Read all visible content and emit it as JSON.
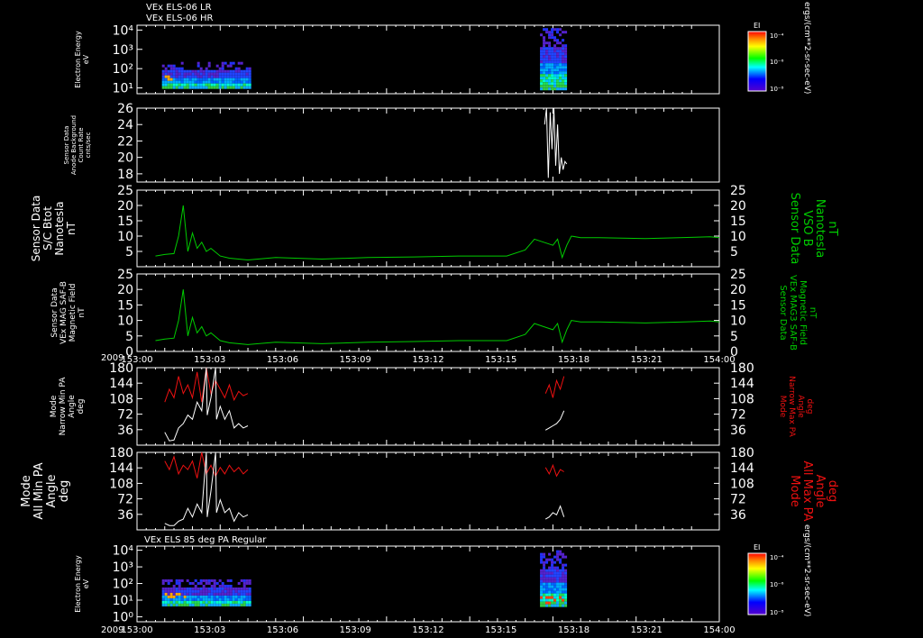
{
  "header": {
    "title1": "VEx ELS-06 LR",
    "title2": "VEx ELS-06 HR"
  },
  "colors": {
    "white": "#ffffff",
    "green": "#00cc00",
    "red": "#ee1111",
    "black": "#000000"
  },
  "time_axis": {
    "year": "2009",
    "ticks": [
      "153:00",
      "153:03",
      "153:06",
      "153:09",
      "153:12",
      "153:15",
      "153:18",
      "153:21",
      "154:00"
    ],
    "range_min": [
      0,
      63
    ]
  },
  "colorbar": {
    "title": "EI",
    "ticks": [
      "10⁻⁴",
      "10⁻⁶",
      "10⁻⁸"
    ],
    "units": "ergs/(cm**2-sr-sec-eV)"
  },
  "chart_data": [
    {
      "id": "p1",
      "type": "heatmap",
      "ylabel": [
        "Electron Energy",
        "eV"
      ],
      "yticks": [
        "10⁴",
        "10³",
        "10²",
        "10¹"
      ],
      "ylog": [
        1,
        4
      ],
      "blocks": [
        {
          "t0": 2.7,
          "t1": 12.1,
          "e0": 0.95,
          "e1": 2.35,
          "level": "medium-low"
        },
        {
          "t0": 43.6,
          "t1": 46.3,
          "e0": 0.9,
          "e1": 4.1,
          "level": "medium"
        }
      ]
    },
    {
      "id": "p2",
      "type": "line",
      "ylabel": [
        "Sensor Data",
        "Anode Background",
        "Count Rate",
        "cnts/sec"
      ],
      "yticks": [
        "26",
        "24",
        "22",
        "20",
        "18"
      ],
      "ylim": [
        17,
        26
      ],
      "series": [
        {
          "color": "white",
          "x": [
            44.1,
            44.3,
            44.5,
            44.7,
            44.9,
            45.1,
            45.3,
            45.5,
            45.7,
            45.9,
            46.1,
            46.3,
            46.5
          ],
          "y": [
            24,
            26,
            17.5,
            25.5,
            21,
            26,
            19,
            24,
            18,
            20,
            18.5,
            19.5,
            19.2
          ]
        }
      ]
    },
    {
      "id": "p3",
      "type": "line",
      "ylabel": [
        "Sensor Data",
        "S/C Btot",
        "Nanotesla",
        "nT"
      ],
      "rlabel": [
        "Sensor Data",
        "VSO B",
        "Nanotesla",
        "nT"
      ],
      "yticks": [
        "25",
        "20",
        "15",
        "10",
        "5"
      ],
      "ylim": [
        0,
        25
      ],
      "series": [
        {
          "color": "green",
          "x": [
            2,
            3,
            4,
            4.5,
            5,
            5.5,
            6,
            6.5,
            7,
            7.5,
            8,
            9,
            10,
            12,
            15,
            20,
            25,
            30,
            35,
            40,
            42,
            43,
            44,
            45,
            45.5,
            46,
            46.5,
            47,
            48,
            50,
            55,
            60,
            62,
            63
          ],
          "y": [
            3.5,
            4,
            4.3,
            10,
            20,
            5,
            11,
            6,
            8,
            5,
            6,
            3.5,
            2.8,
            2.2,
            3,
            2.5,
            3,
            3.2,
            3.5,
            3.5,
            5.5,
            9,
            8,
            7,
            9,
            3,
            7,
            10,
            9.5,
            9.5,
            9.2,
            9.6,
            9.8,
            9.5
          ]
        }
      ]
    },
    {
      "id": "p4",
      "type": "line",
      "ylabel": [
        "Sensor Data",
        "VEx MAG SAF-B",
        "Magnetic Field",
        "nT"
      ],
      "rlabel": [
        "Sensor Data",
        "VEx MAG3 SAF-B",
        "Magnetic Field",
        "nT"
      ],
      "yticks": [
        "25",
        "20",
        "15",
        "10",
        "5",
        "0"
      ],
      "ylim": [
        0,
        25
      ],
      "series": [
        {
          "color": "green",
          "x": [
            2,
            3,
            4,
            4.5,
            5,
            5.5,
            6,
            6.5,
            7,
            7.5,
            8,
            9,
            10,
            12,
            15,
            20,
            25,
            30,
            35,
            40,
            42,
            43,
            44,
            45,
            45.5,
            46,
            46.5,
            47,
            48,
            50,
            55,
            60,
            62,
            63
          ],
          "y": [
            3.5,
            4,
            4.3,
            10,
            20,
            5,
            11,
            6,
            8,
            5,
            6,
            3.5,
            2.8,
            2.2,
            3,
            2.5,
            3,
            3.2,
            3.5,
            3.5,
            5.5,
            9,
            8,
            7,
            9,
            3,
            7,
            10,
            9.5,
            9.5,
            9.2,
            9.6,
            9.8,
            9.5
          ]
        }
      ]
    },
    {
      "id": "p5",
      "type": "line",
      "ylabel": [
        "Mode",
        "Narrow Min PA",
        "Angle",
        "deg"
      ],
      "rlabel": [
        "Mode",
        "Narrow Max PA",
        "Angle",
        "deg"
      ],
      "yticks": [
        "180",
        "144",
        "108",
        "72",
        "36"
      ],
      "ylim": [
        0,
        180
      ],
      "series": [
        {
          "color": "red",
          "x": [
            3,
            3.5,
            4,
            4.5,
            5,
            5.5,
            6,
            6.5,
            7,
            7.5,
            8,
            8.5,
            9,
            9.5,
            10,
            10.5,
            11,
            11.5,
            12
          ],
          "y": [
            100,
            130,
            110,
            160,
            120,
            140,
            110,
            170,
            100,
            180,
            120,
            150,
            130,
            110,
            140,
            105,
            125,
            115,
            120
          ]
        },
        {
          "color": "white",
          "x": [
            3,
            3.5,
            4,
            4.5,
            5,
            5.5,
            6,
            6.5,
            7,
            7.5,
            7.6,
            8,
            8.5,
            8.6,
            9,
            9.5,
            10,
            10.5,
            11,
            11.5,
            12
          ],
          "y": [
            30,
            10,
            12,
            40,
            50,
            70,
            60,
            100,
            80,
            180,
            70,
            110,
            180,
            60,
            90,
            60,
            80,
            40,
            50,
            40,
            45
          ]
        },
        {
          "color": "red",
          "x": [
            44.2,
            44.6,
            45,
            45.4,
            45.8,
            46.2
          ],
          "y": [
            120,
            140,
            110,
            150,
            130,
            160
          ]
        },
        {
          "color": "white",
          "x": [
            44.2,
            44.6,
            45,
            45.4,
            45.8,
            46.2
          ],
          "y": [
            35,
            40,
            45,
            50,
            60,
            80
          ]
        }
      ]
    },
    {
      "id": "p6",
      "type": "line",
      "ylabel": [
        "Mode",
        "All Min PA",
        "Angle",
        "deg"
      ],
      "rlabel": [
        "Mode",
        "All Max PA",
        "Angle",
        "deg"
      ],
      "yticks": [
        "180",
        "144",
        "108",
        "72",
        "36"
      ],
      "ylim": [
        0,
        180
      ],
      "series": [
        {
          "color": "red",
          "x": [
            3,
            3.5,
            4,
            4.5,
            5,
            5.5,
            6,
            6.5,
            7,
            7.5,
            8,
            8.5,
            9,
            9.5,
            10,
            10.5,
            11,
            11.5,
            12
          ],
          "y": [
            160,
            140,
            170,
            130,
            150,
            140,
            160,
            120,
            180,
            130,
            150,
            125,
            145,
            130,
            150,
            135,
            145,
            130,
            140
          ]
        },
        {
          "color": "white",
          "x": [
            3,
            3.5,
            4,
            4.5,
            5,
            5.5,
            6,
            6.5,
            7,
            7.5,
            7.6,
            8,
            8.5,
            8.6,
            9,
            9.5,
            10,
            10.5,
            11,
            11.5,
            12
          ],
          "y": [
            15,
            10,
            10,
            20,
            25,
            50,
            30,
            60,
            40,
            180,
            30,
            90,
            180,
            40,
            70,
            40,
            50,
            20,
            40,
            30,
            35
          ]
        },
        {
          "color": "red",
          "x": [
            44.2,
            44.6,
            45,
            45.4,
            45.8,
            46.2
          ],
          "y": [
            145,
            130,
            150,
            125,
            140,
            135
          ]
        },
        {
          "color": "white",
          "x": [
            44.2,
            44.6,
            45,
            45.4,
            45.8,
            46.2
          ],
          "y": [
            25,
            30,
            40,
            35,
            55,
            30
          ]
        }
      ]
    },
    {
      "id": "p7",
      "type": "heatmap",
      "title": "VEx ELS 85 deg PA Regular",
      "ylabel": [
        "Electron Energy",
        "eV"
      ],
      "yticks": [
        "10⁴",
        "10³",
        "10²",
        "10¹",
        "10⁰"
      ],
      "ylog": [
        0,
        4
      ],
      "blocks": [
        {
          "t0": 2.7,
          "t1": 12.1,
          "e0": 0.65,
          "e1": 2.25,
          "level": "medium-low"
        },
        {
          "t0": 43.6,
          "t1": 46.3,
          "e0": 0.6,
          "e1": 4.0,
          "level": "medium"
        }
      ]
    }
  ]
}
